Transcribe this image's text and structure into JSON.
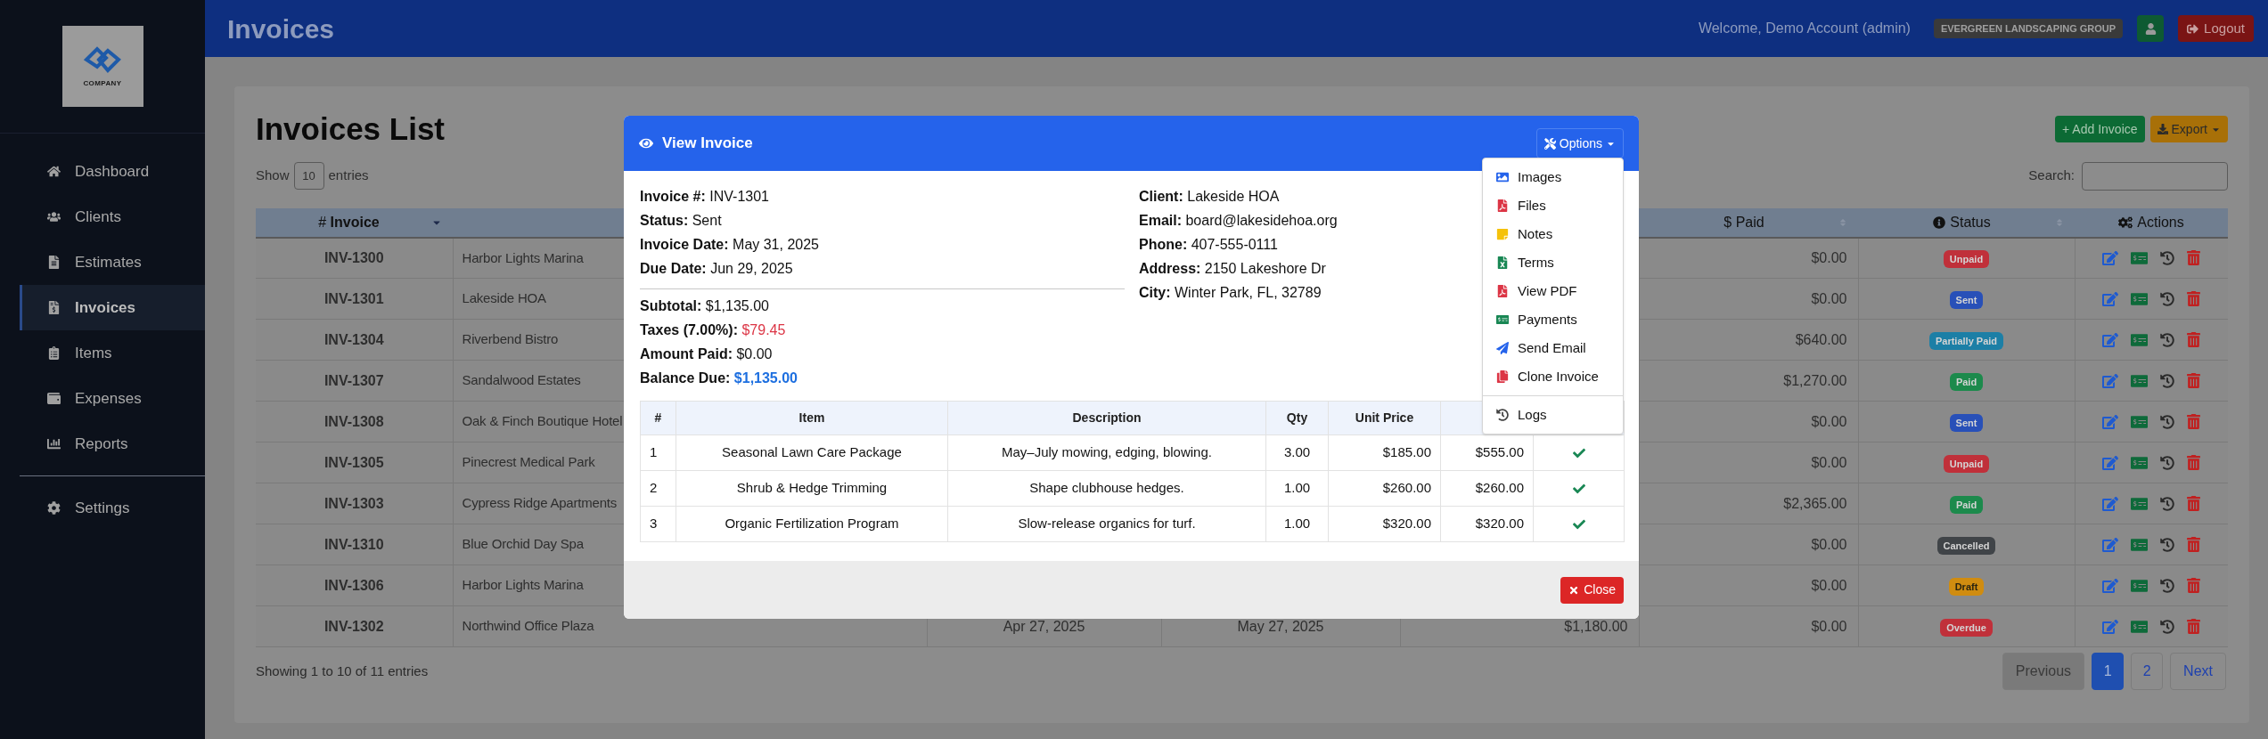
{
  "header": {
    "title": "Invoices",
    "welcome": "Welcome, Demo Account (admin)",
    "company": "EVERGREEN LANDSCAPING GROUP",
    "logout": "Logout"
  },
  "sidebar": {
    "logo_text": "COMPANY",
    "items": [
      {
        "label": "Dashboard",
        "selected": false
      },
      {
        "label": "Clients",
        "selected": false
      },
      {
        "label": "Estimates",
        "selected": false
      },
      {
        "label": "Invoices",
        "selected": true
      },
      {
        "label": "Items",
        "selected": false
      },
      {
        "label": "Expenses",
        "selected": false
      },
      {
        "label": "Reports",
        "selected": false
      }
    ],
    "bottom_items": [
      {
        "label": "Settings",
        "selected": false
      }
    ]
  },
  "page": {
    "title": "Invoices List",
    "add_button": "+ Add Invoice",
    "export_button": "Export",
    "show_label": "Show",
    "entries_value": "10",
    "entries_label": "entries",
    "search_label": "Search:"
  },
  "table": {
    "headers": {
      "invoice": "# **Invoice**",
      "paid": "$ Paid",
      "status": "Status",
      "actions": "Actions"
    },
    "rows": [
      {
        "invoice": "INV-1300",
        "client": "Harbor Lights Marina",
        "paid": "$0.00",
        "status": {
          "label": "Unpaid",
          "color": "#c0303a"
        }
      },
      {
        "invoice": "INV-1301",
        "client": "Lakeside HOA",
        "paid": "$0.00",
        "status": {
          "label": "Sent",
          "color": "#2850b8"
        }
      },
      {
        "invoice": "INV-1304",
        "client": "Riverbend Bistro",
        "paid": "$640.00",
        "status": {
          "label": "Partially Paid",
          "color": "#1c7fa6"
        }
      },
      {
        "invoice": "INV-1307",
        "client": "Sandalwood Estates",
        "paid": "$1,270.00",
        "status": {
          "label": "Paid",
          "color": "#1c8a4c"
        }
      },
      {
        "invoice": "INV-1308",
        "client": "Oak & Finch Boutique Hotel",
        "paid": "$0.00",
        "status": {
          "label": "Sent",
          "color": "#2850b8"
        }
      },
      {
        "invoice": "INV-1305",
        "client": "Pinecrest Medical Park",
        "paid": "$0.00",
        "status": {
          "label": "Unpaid",
          "color": "#c0303a"
        }
      },
      {
        "invoice": "INV-1303",
        "client": "Cypress Ridge Apartments",
        "paid": "$2,365.00",
        "status": {
          "label": "Paid",
          "color": "#1c8a4c"
        }
      },
      {
        "invoice": "INV-1310",
        "client": "Blue Orchid Day Spa",
        "paid": "$0.00",
        "status": {
          "label": "Cancelled",
          "color": "#404448"
        }
      },
      {
        "invoice": "INV-1306",
        "client": "Harbor Lights Marina",
        "paid": "$0.00",
        "status": {
          "label": "Draft",
          "color": "#d08c10"
        }
      },
      {
        "invoice": "INV-1302",
        "client": "Northwind Office Plaza",
        "issued": "Apr 27, 2025",
        "due": "May 27, 2025",
        "total": "$1,180.00",
        "paid": "$0.00",
        "status": {
          "label": "Overdue",
          "color": "#c0303a"
        }
      }
    ]
  },
  "footer": {
    "summary": "Showing 1 to 10 of 11 entries",
    "previous": {
      "label": "Previous",
      "disabled": true
    },
    "pages": [
      {
        "label": "1",
        "selected": true
      },
      {
        "label": "2",
        "selected": false
      }
    ],
    "next": {
      "label": "Next",
      "disabled": false
    }
  },
  "modal": {
    "title": "View Invoice",
    "options_button": "Options",
    "invoice_details": [
      {
        "label": "Invoice #:",
        "value": "INV-1301"
      },
      {
        "label": "Status:",
        "value": "Sent"
      },
      {
        "label": "Invoice Date:",
        "value": "May 31, 2025"
      },
      {
        "label": "Due Date:",
        "value": "Jun 29, 2025"
      }
    ],
    "totals": [
      {
        "label": "Subtotal:",
        "value": "$1,135.00",
        "kind": "plain"
      },
      {
        "label": "Taxes (7.00%):",
        "value": "$79.45",
        "kind": "tax"
      },
      {
        "label": "Amount Paid:",
        "value": "$0.00",
        "kind": "plain"
      },
      {
        "label": "Balance Due:",
        "value": "$1,135.00",
        "kind": "balance"
      }
    ],
    "client_details": [
      {
        "label": "Client:",
        "value": "Lakeside HOA"
      },
      {
        "label": "Email:",
        "value": "board@lakesidehoa.org"
      },
      {
        "label": "Phone:",
        "value": "407-555-0111"
      },
      {
        "label": "Address:",
        "value": "2150 Lakeshore Dr"
      },
      {
        "label": "City:",
        "value": "Winter Park, FL, 32789"
      }
    ],
    "items_columns": [
      "#",
      "Item",
      "Description",
      "Qty",
      "Unit Price"
    ],
    "items": [
      {
        "no": "1",
        "item": "Seasonal Lawn Care Package",
        "description": "May–July mowing, edging, blowing.",
        "qty": "3.00",
        "unit_price": "$185.00",
        "total": "$555.00",
        "checked": true
      },
      {
        "no": "2",
        "item": "Shrub & Hedge Trimming",
        "description": "Shape clubhouse hedges.",
        "qty": "1.00",
        "unit_price": "$260.00",
        "total": "$260.00",
        "checked": true
      },
      {
        "no": "3",
        "item": "Organic Fertilization Program",
        "description": "Slow-release organics for turf.",
        "qty": "1.00",
        "unit_price": "$320.00",
        "total": "$320.00",
        "checked": true
      }
    ],
    "close_button": "Close",
    "menu": {
      "items": [
        {
          "label": "Images"
        },
        {
          "label": "Files"
        },
        {
          "label": "Notes"
        },
        {
          "label": "Terms"
        },
        {
          "label": "View PDF"
        },
        {
          "label": "Payments"
        },
        {
          "label": "Send Email"
        },
        {
          "label": "Clone Invoice"
        }
      ],
      "footer_items": [
        {
          "label": "Logs"
        }
      ]
    }
  }
}
